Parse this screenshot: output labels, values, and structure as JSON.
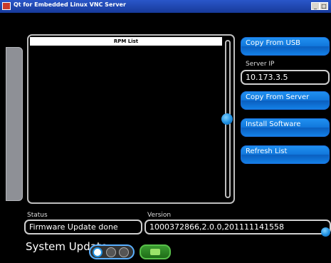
{
  "window": {
    "title": "Qt for Embedded Linux VNC Server",
    "btn_min": "_",
    "btn_max": "□"
  },
  "list": {
    "header": "RPM List",
    "items": []
  },
  "buttons": {
    "copy_usb": "Copy From USB",
    "copy_server": "Copy From Server",
    "install": "Install Software",
    "refresh": "Refresh List"
  },
  "server": {
    "label": "Server IP",
    "value": "10.173.3.5"
  },
  "status": {
    "label": "Status",
    "value": "Firmware Update done"
  },
  "version": {
    "label": "Version",
    "value": "1000372866,2.0.0,201111141558"
  },
  "section_title": "System Update",
  "colors": {
    "accent_blue": "#1278dc",
    "accent_green": "#3a9a30",
    "titlebar": "#2a57c9"
  }
}
